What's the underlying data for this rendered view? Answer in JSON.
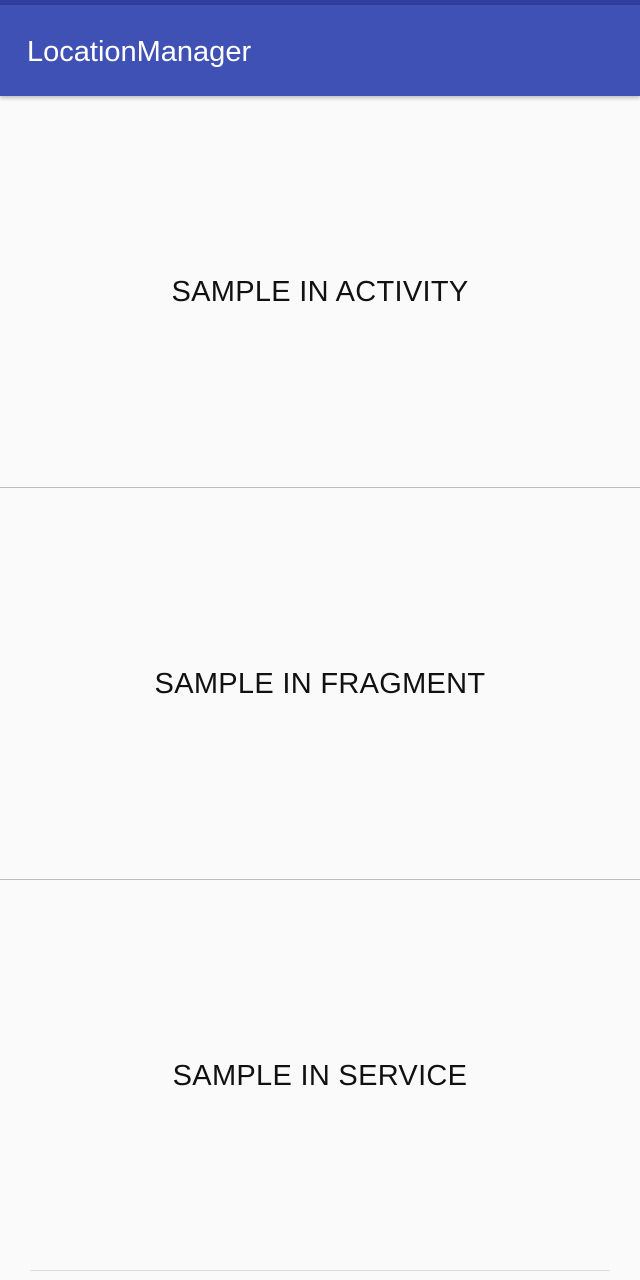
{
  "app": {
    "title": "LocationManager",
    "primary_color": "#3f51b5",
    "primary_dark_color": "#303f9f",
    "background_color": "#fafafa"
  },
  "buttons": [
    {
      "label": "SAMPLE IN ACTIVITY"
    },
    {
      "label": "SAMPLE IN FRAGMENT"
    },
    {
      "label": "SAMPLE IN SERVICE"
    }
  ]
}
